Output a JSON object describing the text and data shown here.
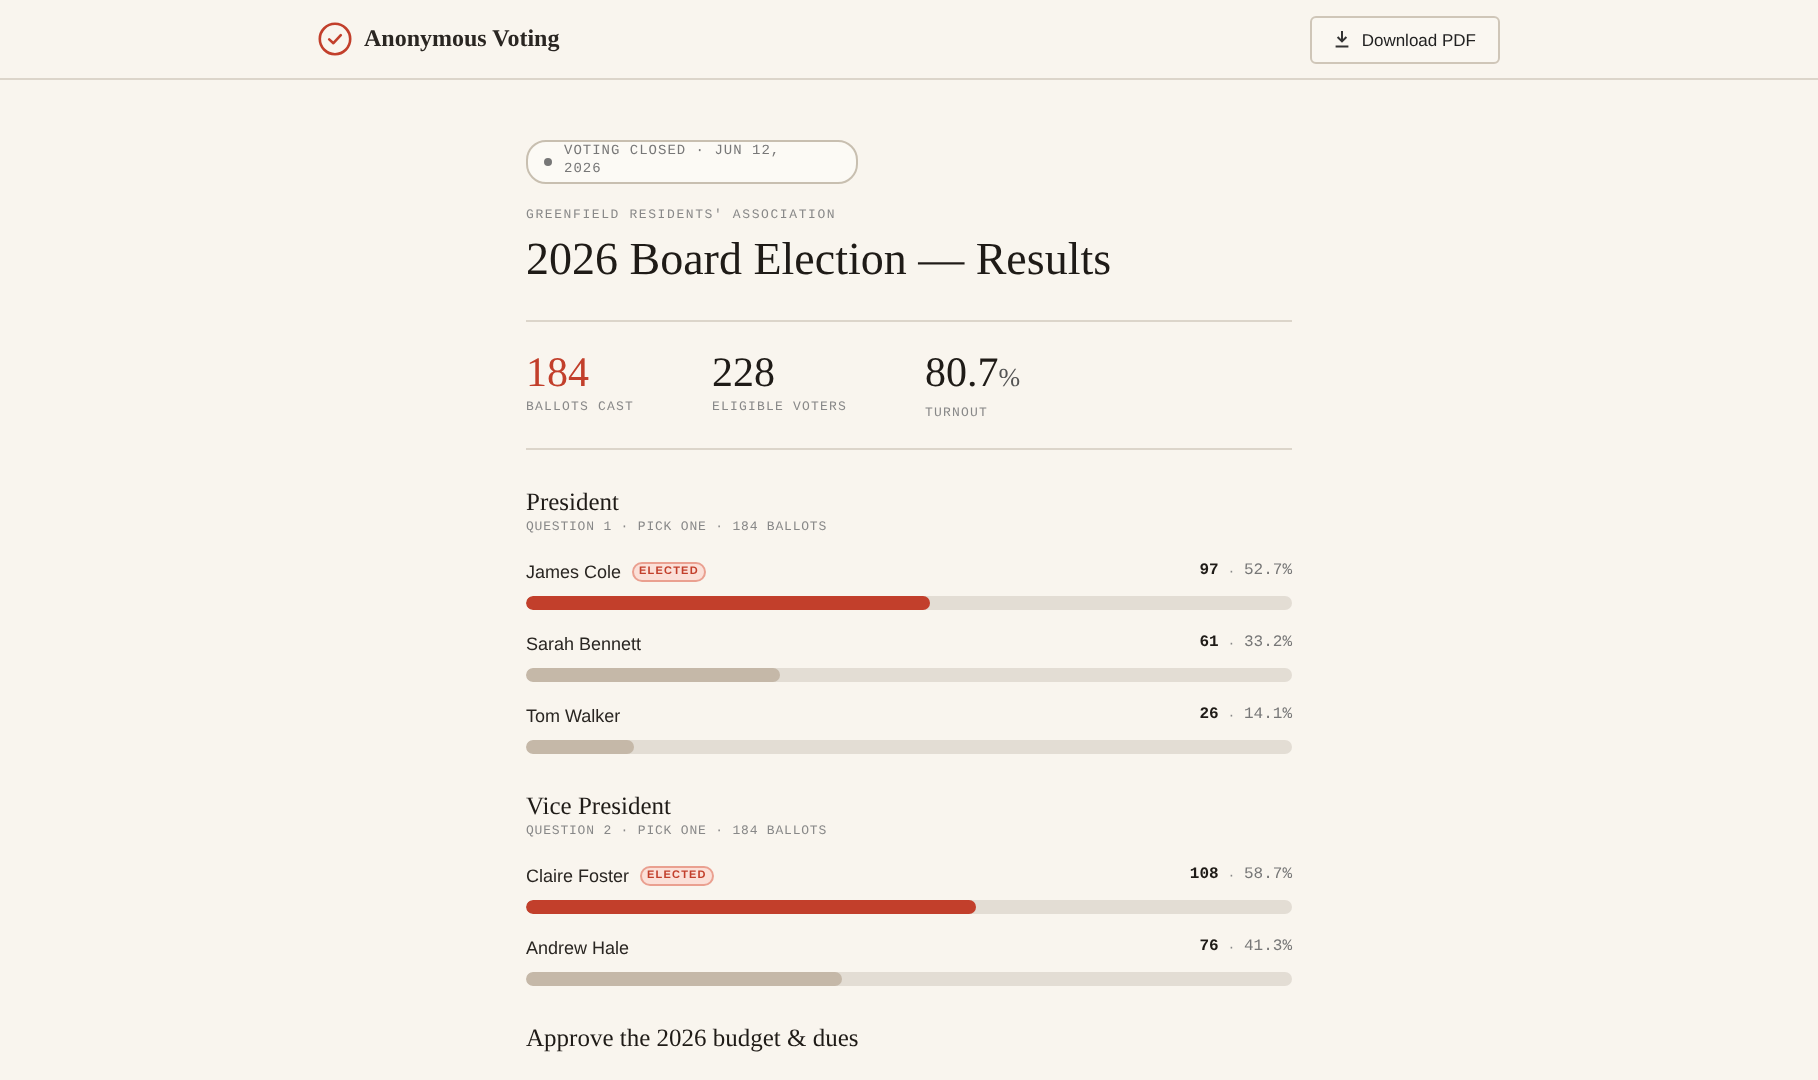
{
  "header": {
    "app_name": "Anonymous Voting",
    "download_button": "Download PDF"
  },
  "status_badge": "VOTING CLOSED · JUN 12, 2026",
  "organization": "GREENFIELD RESIDENTS' ASSOCIATION",
  "title": "2026 Board Election — Results",
  "stats": [
    {
      "value": "184",
      "label": "BALLOTS CAST",
      "highlight": true
    },
    {
      "value": "228",
      "label": "ELIGIBLE VOTERS",
      "highlight": false
    },
    {
      "value": "80.7",
      "unit": "%",
      "label": "TURNOUT",
      "highlight": false
    }
  ],
  "questions": [
    {
      "title": "President",
      "subtitle": "QUESTION 1 · PICK ONE · 184 BALLOTS",
      "candidates": [
        {
          "name": "James Cole",
          "elected": true,
          "badge": "ELECTED",
          "votes": "97",
          "separator": "·",
          "percent": "52.7%",
          "level": 0.527
        },
        {
          "name": "Sarah Bennett",
          "elected": false,
          "votes": "61",
          "separator": "·",
          "percent": "33.2%",
          "level": 0.332
        },
        {
          "name": "Tom Walker",
          "elected": false,
          "votes": "26",
          "separator": "·",
          "percent": "14.1%",
          "level": 0.141
        }
      ]
    },
    {
      "title": "Vice President",
      "subtitle": "QUESTION 2 · PICK ONE · 184 BALLOTS",
      "candidates": [
        {
          "name": "Claire Foster",
          "elected": true,
          "badge": "ELECTED",
          "votes": "108",
          "separator": "·",
          "percent": "58.7%",
          "level": 0.587
        },
        {
          "name": "Andrew Hale",
          "elected": false,
          "votes": "76",
          "separator": "·",
          "percent": "41.3%",
          "level": 0.413
        }
      ]
    },
    {
      "title": "Approve the 2026 budget & dues"
    }
  ]
}
